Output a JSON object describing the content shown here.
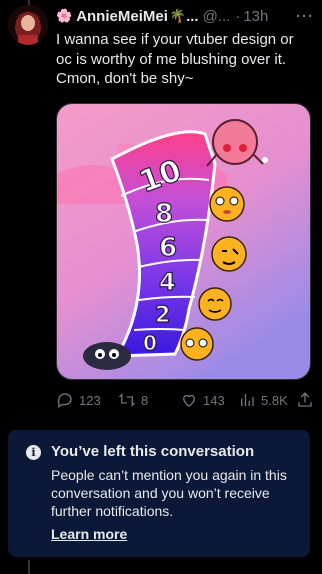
{
  "tweet": {
    "display_name": "AnnieMeiMei",
    "name_truncation": "...",
    "handle": "@...",
    "separator": "·",
    "time": "13h",
    "more": "···",
    "text": "I wanna see if your vtuber design or oc is worthy of me blushing over it. Cmon, don't be shy~"
  },
  "media": {
    "scale_numbers": [
      "10",
      "8",
      "6",
      "4",
      "2",
      "0"
    ]
  },
  "actions": {
    "replies": "123",
    "reposts": "8",
    "likes": "143",
    "views": "5.8K"
  },
  "notice": {
    "title": "You’ve left this conversation",
    "body": "People can’t mention you again in this conversation and you won’t receive further notifications.",
    "link": "Learn more"
  },
  "icons": [
    "flower-icon",
    "palm-tree-icon",
    "reply-icon",
    "repost-icon",
    "like-icon",
    "views-icon",
    "share-icon",
    "info-icon"
  ],
  "colors": {
    "background": "#000000",
    "text": "#e7e9ea",
    "secondary": "#71767b",
    "notice_bg": "#0b1838"
  }
}
